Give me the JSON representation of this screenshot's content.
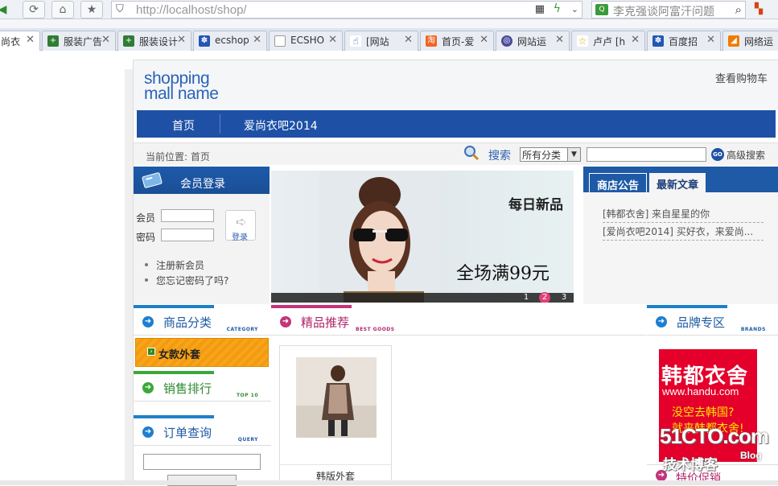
{
  "browser": {
    "url_host": "http://localhost",
    "url_path": "/shop/",
    "search_text": "李克强谈阿富汗问题",
    "tabs": [
      {
        "label": "尚衣",
        "active": true
      },
      {
        "label": "服装广告"
      },
      {
        "label": "服装设计"
      },
      {
        "label": "ecshop"
      },
      {
        "label": "ECSHO"
      },
      {
        "label": "[网站"
      },
      {
        "label": "首页-爱"
      },
      {
        "label": "网站运"
      },
      {
        "label": "卢卢 [h"
      },
      {
        "label": "百度招"
      },
      {
        "label": "网络运"
      }
    ]
  },
  "site": {
    "logo_line1": "shopping",
    "logo_line2": "mall name",
    "cart_link": "查看购物车",
    "nav": [
      "首页",
      "爱尚衣吧2014"
    ],
    "breadcrumb": "当前位置: 首页",
    "search_label": "搜索",
    "category_select": "所有分类",
    "search_go": "GO",
    "advanced_search": "高级搜索"
  },
  "login": {
    "title": "会员登录",
    "user_label": "会员",
    "password_label": "密码",
    "login_button": "登录",
    "links": [
      "注册新会员",
      "您忘记密码了吗?"
    ]
  },
  "banner": {
    "headline": "每日新品",
    "promo": "全场满99元",
    "pages": [
      "1",
      "2",
      "3"
    ],
    "active_page": "2"
  },
  "notice": {
    "tabs": [
      "商店公告",
      "最新文章"
    ],
    "articles": [
      "[韩都衣舍] 来自星星的你",
      "[爱尚衣吧2014] 买好衣，来爱尚..."
    ]
  },
  "sidebar": {
    "category": {
      "title": "商品分类",
      "en": "CATEGORY",
      "items": [
        "女款外套"
      ]
    },
    "top10": {
      "title": "销售排行",
      "en": "TOP 10"
    },
    "order": {
      "title": "订单查询",
      "en": "QUERY"
    }
  },
  "goods": {
    "title": "精品推荐",
    "en": "BEST GOODS",
    "items": [
      {
        "name": "韩版外套"
      }
    ]
  },
  "brands": {
    "title": "品牌专区",
    "en": "BRANDS",
    "brand_name": "韩都衣舍",
    "brand_url": "www.handu.com",
    "brand_slogan1": "没空去韩国?",
    "brand_slogan2": "就来韩都衣舍!",
    "special_title": "特价促销"
  },
  "watermark": {
    "line1": "51CTO.com",
    "line2": "技术博客",
    "line3": "Blog"
  },
  "colors": {
    "nav_blue": "#1e51a6",
    "accent_pink": "#e0407a",
    "category_orange": "#f7a51a",
    "brand_red": "#e4002b"
  }
}
